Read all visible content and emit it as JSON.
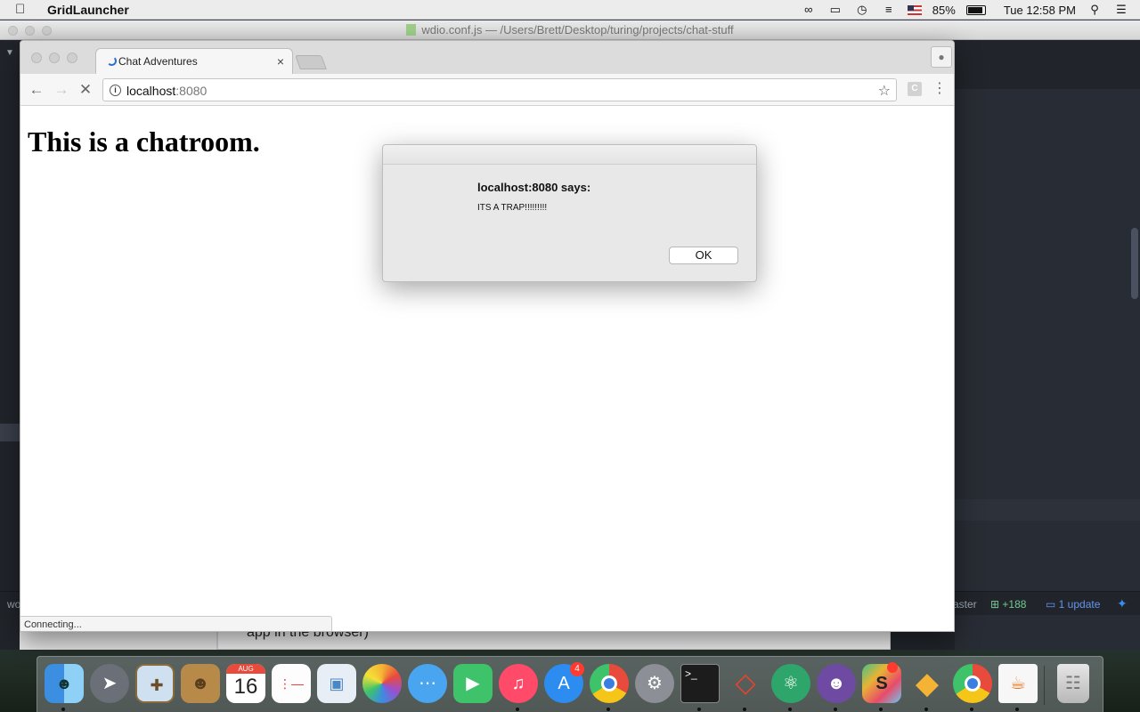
{
  "menubar": {
    "app_name": "GridLauncher",
    "battery": "85%",
    "clock": "Tue 12:58 PM"
  },
  "atom": {
    "window_title": "wdio.conf.js — /Users/Brett/Desktop/turing/projects/chat-stuff",
    "status_left": "wo",
    "branch": "aster",
    "diff_count": "+188",
    "update_label": "1 update"
  },
  "notes": {
    "text": "app in the browser)"
  },
  "chrome": {
    "tab_title": "Chat Adventures",
    "url_host": "localhost",
    "url_port": ":8080",
    "extension_label": "C",
    "status_text": "Connecting..."
  },
  "page": {
    "heading": "This is a chatroom."
  },
  "dialog": {
    "header": "localhost:8080 says:",
    "message": "ITS A TRAP!!!!!!!!!",
    "ok_label": "OK"
  },
  "dock": {
    "calendar_month": "AUG",
    "calendar_day": "16",
    "app_store_badge": "4"
  }
}
